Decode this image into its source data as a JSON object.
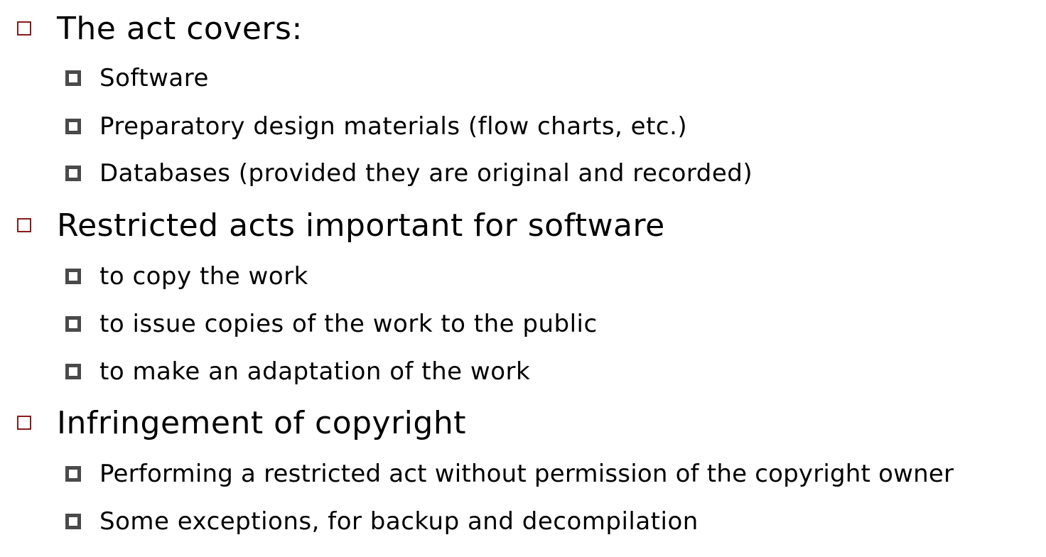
{
  "sections": [
    {
      "heading": "The act covers:",
      "items": [
        "Software",
        "Preparatory design materials (flow charts, etc.)",
        "Databases (provided they are original and recorded)"
      ]
    },
    {
      "heading": "Restricted acts important for software",
      "items": [
        "to copy the work",
        "to issue copies of the work to the public",
        "to make an adaptation of the work"
      ]
    },
    {
      "heading": "Infringement of copyright",
      "items": [
        "Performing a restricted act without permission of the copyright owner",
        "Some exceptions, for backup and decompilation"
      ]
    }
  ],
  "colors": {
    "level1_bullet": "#8b1a1a",
    "level2_bullet": "#4a4a4a"
  }
}
